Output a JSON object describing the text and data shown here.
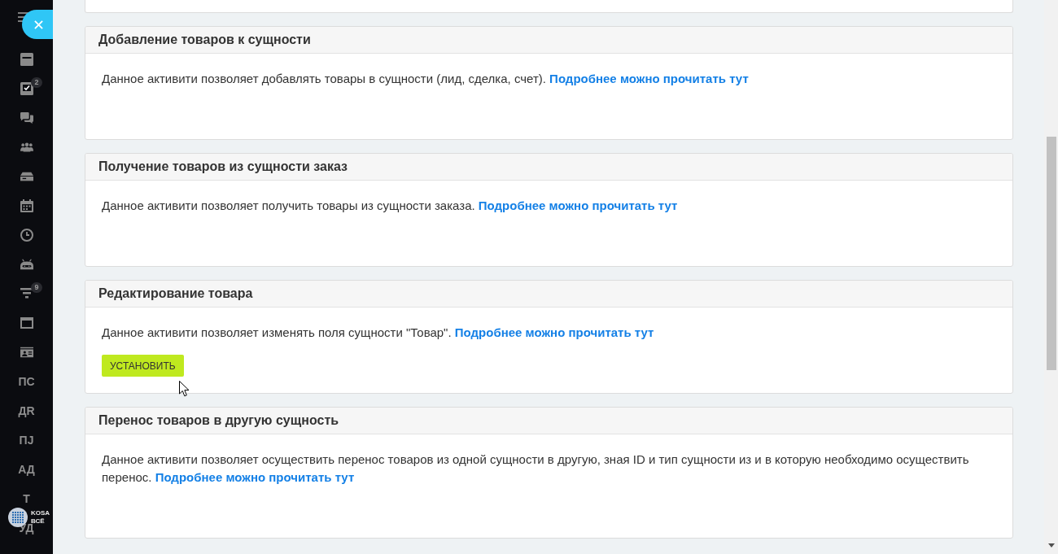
{
  "sidebar": {
    "items": [
      {
        "kind": "icon"
      },
      {
        "kind": "icon",
        "badge": "2"
      },
      {
        "kind": "icon"
      },
      {
        "kind": "icon"
      },
      {
        "kind": "icon"
      },
      {
        "kind": "icon"
      },
      {
        "kind": "icon"
      },
      {
        "kind": "icon"
      },
      {
        "kind": "icon",
        "badge": "9"
      },
      {
        "kind": "icon"
      },
      {
        "kind": "icon"
      },
      {
        "kind": "text",
        "label": "ПС"
      },
      {
        "kind": "text",
        "label": "ДR"
      },
      {
        "kind": "text",
        "label": "ПJ"
      },
      {
        "kind": "text",
        "label": "АД"
      },
      {
        "kind": "text",
        "label": "Т"
      },
      {
        "kind": "text",
        "label": "УД"
      }
    ],
    "logo": {
      "line_1": "KOSA",
      "line_2": "ВСЁ"
    }
  },
  "cards": [
    {
      "title": "Добавление товаров к сущности",
      "description": "Данное активити позволяет добавлять товары в сущности (лид, сделка, счет).",
      "link": "Подробнее можно прочитать тут"
    },
    {
      "title": "Получение товаров из сущности заказ",
      "description": "Данное активити позволяет получить товары из сущности заказа.",
      "link": "Подробнее можно прочитать тут"
    },
    {
      "title": "Редактирование товара",
      "description": "Данное активити позволяет изменять поля сущности \"Товар\".",
      "link": "Подробнее можно прочитать тут",
      "button": "УСТАНОВИТЬ"
    },
    {
      "title": "Перенос товаров в другую сущность",
      "description": "Данное активити позволяет осуществить перенос товаров из одной сущности в другую, зная ID и тип сущности из и в которую необходимо осуществить перенос.",
      "link": "Подробнее можно прочитать тут"
    }
  ]
}
